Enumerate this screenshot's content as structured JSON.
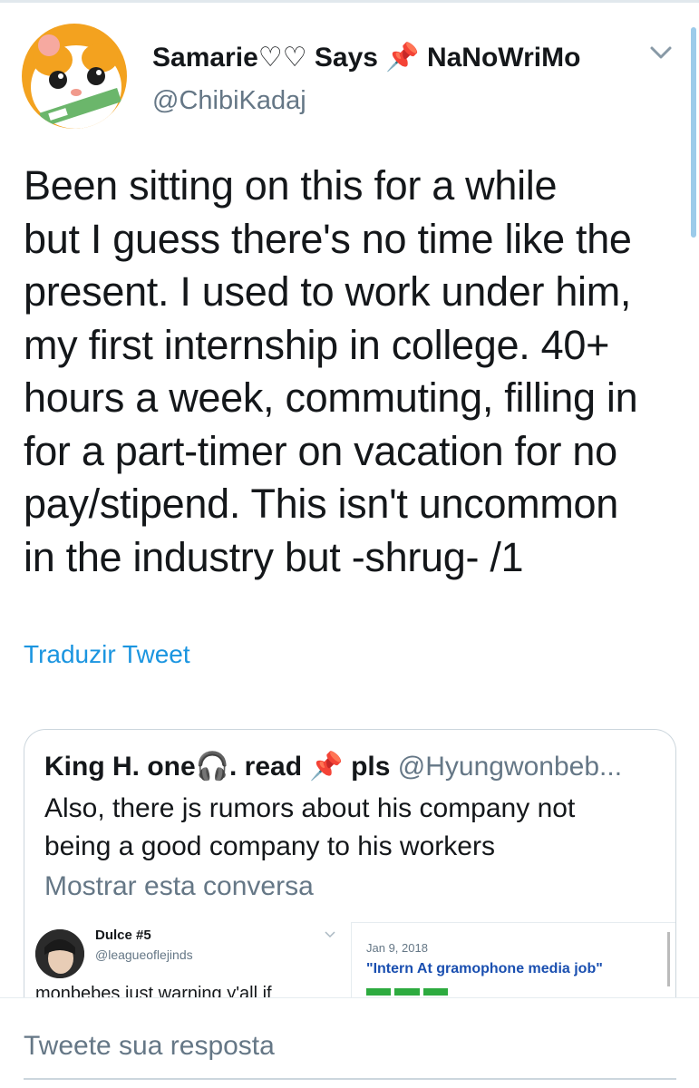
{
  "tweet": {
    "display_name": "Samarie♡♡ Says 📌 NaNoWriMo",
    "handle": "@ChibiKadaj",
    "text": "Been sitting on this for a while\nbut I guess there's no time like the\npresent. I used to work under him,\nmy first internship in college. 40+\nhours a week, commuting, filling in\nfor a part-timer on vacation for no\npay/stipend. This isn't uncommon\nin the industry but -shrug- /1",
    "translate_label": "Traduzir Tweet"
  },
  "quoted": {
    "name": "King H. one🎧.   read 📌 pls",
    "handle": "@Hyungwonbeb...",
    "text": "Also, there js rumors about his company not\nbeing a good company to his workers",
    "show_conversation": "Mostrar esta conversa"
  },
  "embedded_tweet": {
    "name": "Dulce #5",
    "handle": "@leagueoflejinds",
    "text": "monbebes just warning y'all if"
  },
  "embedded_article": {
    "date": "Jan 9, 2018",
    "title": "\"Intern At gramophone media job\""
  },
  "reply": {
    "placeholder": "Tweete sua resposta"
  },
  "colors": {
    "link": "#1b95e0",
    "secondary": "#657786",
    "text": "#14171a"
  },
  "icons": [
    "chevron-down-icon",
    "avatar-hamster",
    "pin-icon",
    "headphones-icon"
  ]
}
